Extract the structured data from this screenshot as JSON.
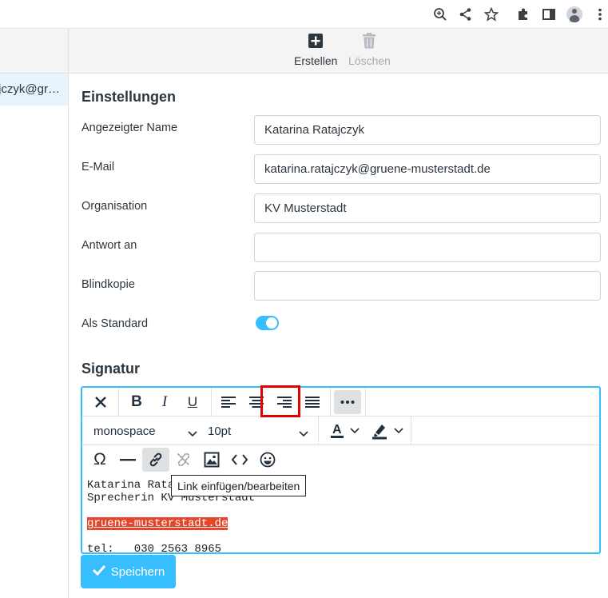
{
  "browser": {
    "icons": [
      "zoom-icon",
      "share-icon",
      "star-icon",
      "extensions-icon",
      "sidepanel-icon",
      "profile-icon",
      "menu-icon"
    ]
  },
  "list": {
    "selected_identity": "katarina.ratajczyk@gr…"
  },
  "toolbar": {
    "create_label": "Erstellen",
    "delete_label": "Löschen"
  },
  "settings": {
    "heading": "Einstellungen",
    "fields": [
      {
        "label": "Angezeigter Name",
        "value": "Katarina Ratajczyk"
      },
      {
        "label": "E-Mail",
        "value": "katarina.ratajczyk@gruene-musterstadt.de"
      },
      {
        "label": "Organisation",
        "value": "KV Musterstadt"
      },
      {
        "label": "Antwort an",
        "value": ""
      },
      {
        "label": "Blindkopie",
        "value": ""
      }
    ],
    "default_label": "Als Standard",
    "default_on": true
  },
  "signature": {
    "heading": "Signatur",
    "font_family": "monospace",
    "font_size": "10pt",
    "tooltip": "Link einfügen/bearbeiten",
    "lines": [
      "Katarina Ratajczyk",
      "Sprecherin KV Musterstadt",
      "",
      "gruene-musterstadt.de",
      "",
      "tel:   030 2563 8965"
    ]
  },
  "save_label": "Speichern",
  "accent_color": "#37beff",
  "highlight_color": "#e00000"
}
